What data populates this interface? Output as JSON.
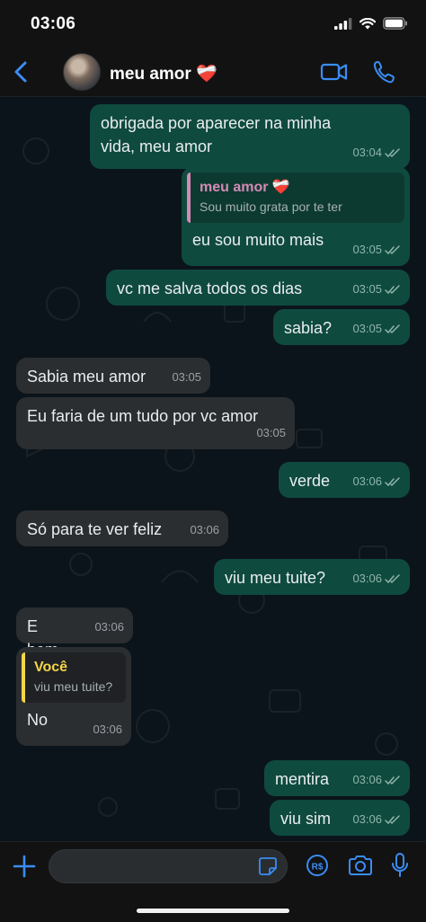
{
  "status_bar": {
    "time": "03:06"
  },
  "header": {
    "contact_name": "meu amor ❤️‍🩹"
  },
  "messages": [
    {
      "dir": "out",
      "text": "obrigada por aparecer na minha vida, meu amor",
      "time": "03:04"
    },
    {
      "dir": "out",
      "quote": {
        "author": "meu amor ❤️‍🩹",
        "text": "Sou muito grata por te ter"
      },
      "text": "eu sou muito mais",
      "time": "03:05"
    },
    {
      "dir": "out",
      "text": "vc me salva todos os dias",
      "time": "03:05"
    },
    {
      "dir": "out",
      "text": "sabia?",
      "time": "03:05"
    },
    {
      "dir": "in",
      "text": "Sabia meu amor",
      "time": "03:05"
    },
    {
      "dir": "in",
      "text": "Eu faria de um tudo por vc amor",
      "time": "03:05"
    },
    {
      "dir": "out",
      "text": "verde",
      "time": "03:06"
    },
    {
      "dir": "in",
      "text": "Só para te ver feliz",
      "time": "03:06"
    },
    {
      "dir": "out",
      "text": "viu meu tuite?",
      "time": "03:06"
    },
    {
      "dir": "in",
      "text": "E bem",
      "time": "03:06"
    },
    {
      "dir": "in",
      "quote": {
        "author": "Você",
        "text": "viu meu tuite?"
      },
      "text": "No",
      "time": "03:06"
    },
    {
      "dir": "out",
      "text": "mentira",
      "time": "03:06"
    },
    {
      "dir": "out",
      "text": "viu sim",
      "time": "03:06"
    }
  ],
  "composer": {
    "placeholder": ""
  },
  "colors": {
    "accent": "#3a8df5",
    "outgoing_bubble": "#0f4a3f",
    "incoming_bubble": "#2b2e31",
    "quote_pink": "#d48ab4",
    "quote_yellow": "#f5d547"
  },
  "icons": [
    "back-chevron-icon",
    "video-camera-icon",
    "phone-icon",
    "plus-icon",
    "sticker-icon",
    "pix-payment-icon",
    "camera-icon",
    "microphone-icon",
    "double-check-icon"
  ]
}
